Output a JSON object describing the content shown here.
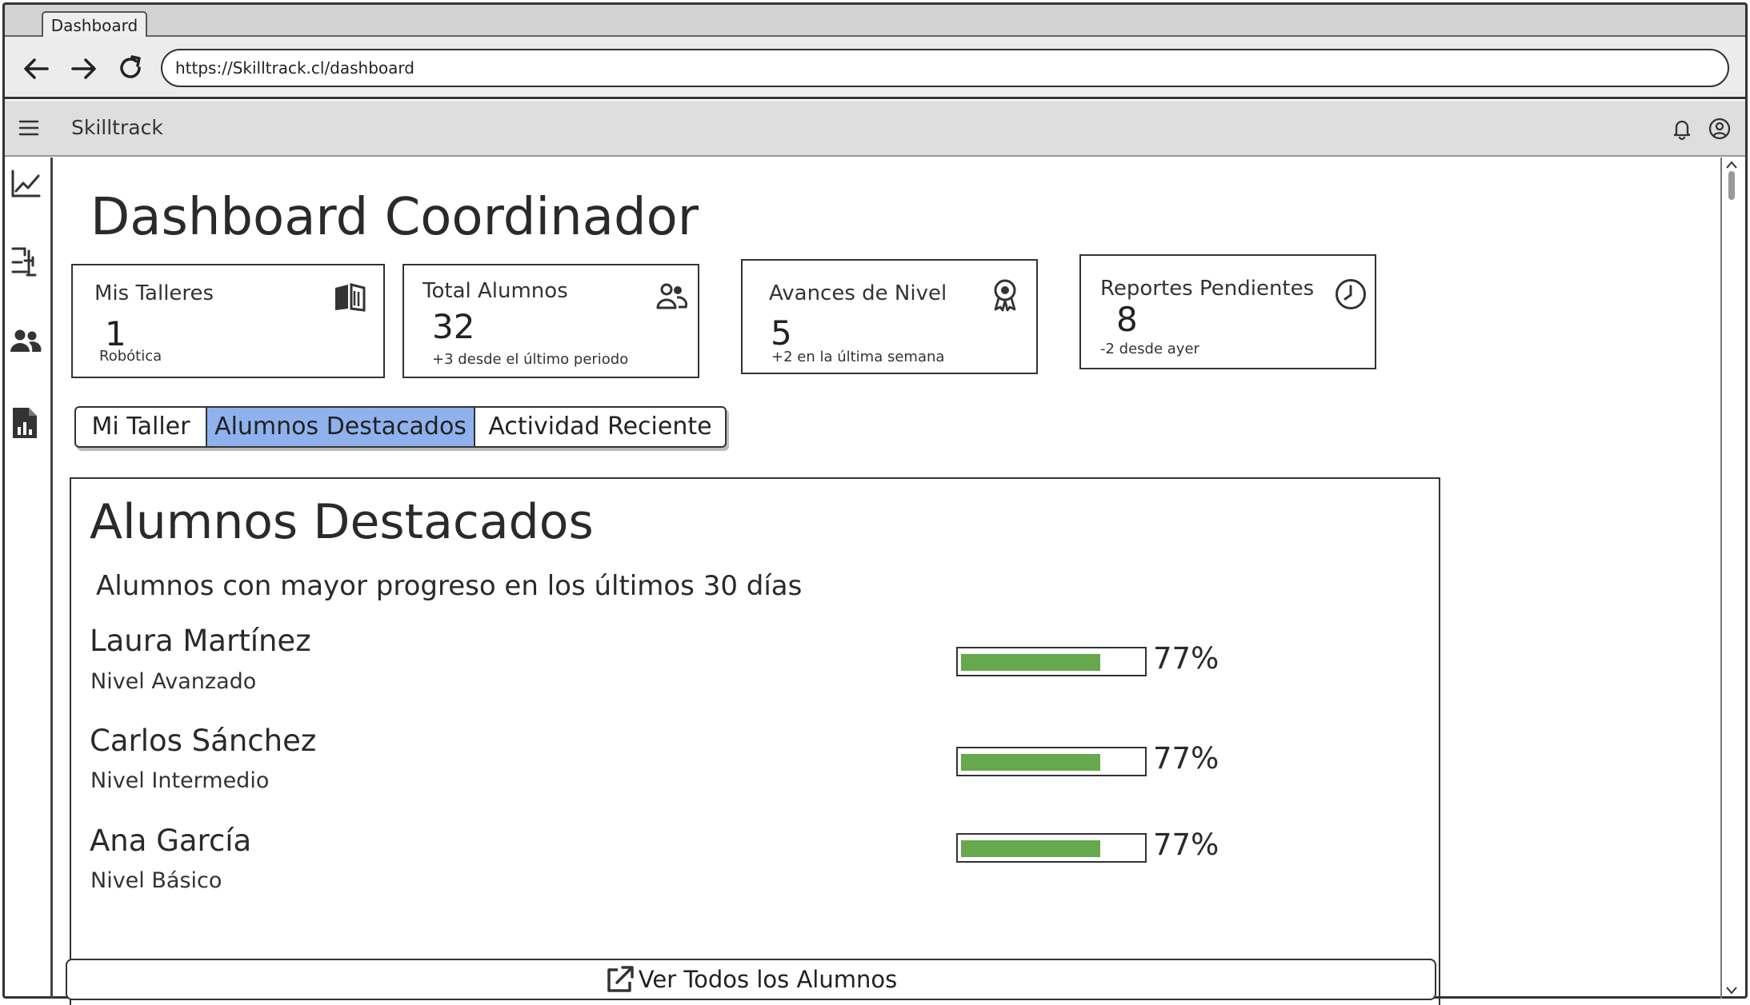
{
  "browser": {
    "tab_title": "Dashboard",
    "url": "https://Skilltrack.cl/dashboard"
  },
  "app": {
    "name": "Skilltrack"
  },
  "sidebar": {
    "items": [
      {
        "icon": "line-chart-icon"
      },
      {
        "icon": "workshop-icon"
      },
      {
        "icon": "users-icon"
      },
      {
        "icon": "report-icon"
      }
    ]
  },
  "page": {
    "title": "Dashboard Coordinador"
  },
  "cards": [
    {
      "title": "Mis Talleres",
      "value": "1",
      "sub": "Robótica",
      "icon": "book-icon"
    },
    {
      "title": "Total Alumnos",
      "value": "32",
      "sub": "+3 desde el último periodo",
      "icon": "users-icon"
    },
    {
      "title": "Avances de Nivel",
      "value": "5",
      "sub": "+2 en la última semana",
      "icon": "award-icon"
    },
    {
      "title": "Reportes Pendientes",
      "value": "8",
      "sub": "-2 desde ayer",
      "icon": "clock-icon"
    }
  ],
  "tabs": [
    {
      "label": "Mi Taller",
      "active": false
    },
    {
      "label": "Alumnos Destacados",
      "active": true
    },
    {
      "label": "Actividad Reciente",
      "active": false
    }
  ],
  "colors": {
    "active_tab": "#8fb2ee",
    "progress": "#66a84c"
  },
  "panel": {
    "title": "Alumnos Destacados",
    "subtitle": "Alumnos con mayor progreso en los últimos 30 días",
    "students": [
      {
        "name": "Laura Martínez",
        "level": "Nivel Avanzado",
        "progress": 0.77,
        "progress_label": "77%"
      },
      {
        "name": "Carlos Sánchez",
        "level": "Nivel Intermedio",
        "progress": 0.77,
        "progress_label": "77%"
      },
      {
        "name": "Ana García",
        "level": "Nivel Básico",
        "progress": 0.77,
        "progress_label": "77%"
      }
    ],
    "view_all_label": "Ver Todos los Alumnos"
  }
}
